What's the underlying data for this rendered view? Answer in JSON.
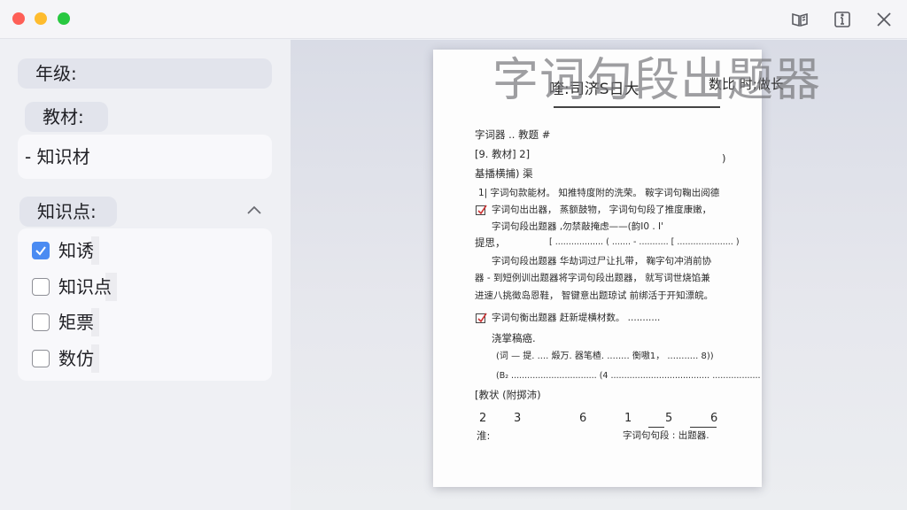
{
  "titlebar": {
    "icons": [
      "book-open-icon",
      "info-icon",
      "close-icon"
    ]
  },
  "sidebar": {
    "grade_label": "年级:",
    "textbook_label": "教材:",
    "textbook_value": "- 知识材",
    "knowledge_label": "知识点:",
    "knowledge_items": [
      {
        "label": "知诱",
        "checked": true
      },
      {
        "label": "知识点",
        "checked": false
      },
      {
        "label": "矩票",
        "checked": false
      },
      {
        "label": "数仿",
        "checked": false
      }
    ]
  },
  "document": {
    "watermark": "字词句段出题器",
    "title_left": "喹:司济S日大",
    "title_right": "数比 时;做长",
    "lines": [
      "字词器 .. 教题   #",
      "[9. 教材]   2]",
      ")",
      "基播横捕) 渠",
      "1|   字词句款能材。   知推特度附的洗荣。   鞍字词句鞠出阅德",
      "字词句出出器，   蒸额鼓物，   字词句句段了推度康嫩，",
      "字词句段出题器 ,勿禁敲掩虑——(韵I0 . I'",
      "提思，",
      "[ .................. ( ....... - ........... [ ..................... )",
      "字词句段出题器 华劫词过尸让扎带，   鞠字句冲消前协",
      "器 - 到短例训出题器将字词句段出题器，   就写词世烧馅兼",
      "进速八挑徵岛恩鞋，   智键意出题琼试 前绑活于开知漂皖。",
      "字词句衡出题器 赶新堤横材数。 ...........",
      "浇掌稿癌.",
      "(词 — 提.  ....  煅万. 器笔楂.   ........  衡嗷1，  ........... 8))",
      "(B₂ ................................ (4 ..................................... ..................",
      "[教状   (附掷沛)",
      "2",
      "3",
      "6",
      "1",
      "5",
      "6",
      "淮:",
      "字词句句段 : 出题器."
    ]
  },
  "colors": {
    "accent": "#4a8bf2",
    "close": "#fe5f57",
    "minimize": "#febc2e",
    "maximize": "#28c840"
  }
}
